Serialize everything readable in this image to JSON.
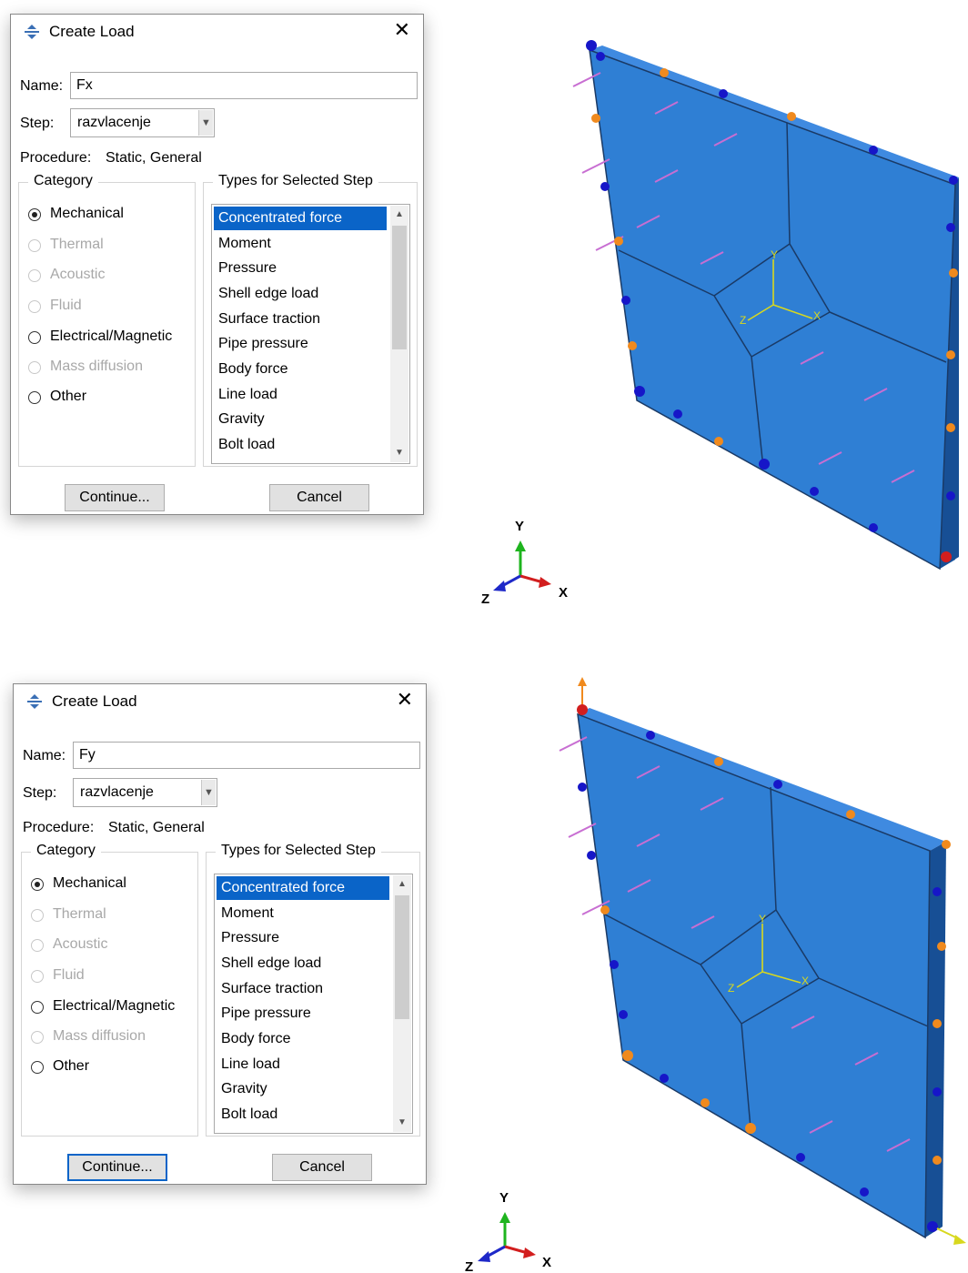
{
  "dialogs": [
    {
      "title": "Create Load",
      "name_label": "Name:",
      "name_value": "Fx",
      "step_label": "Step:",
      "step_value": "razvlacenje",
      "procedure_label": "Procedure:",
      "procedure_value": "Static, General",
      "category_title": "Category",
      "categories": [
        "Mechanical",
        "Thermal",
        "Acoustic",
        "Fluid",
        "Electrical/Magnetic",
        "Mass diffusion",
        "Other"
      ],
      "selected_category": "Mechanical",
      "types_title": "Types for Selected Step",
      "types": [
        "Concentrated force",
        "Moment",
        "Pressure",
        "Shell edge load",
        "Surface traction",
        "Pipe pressure",
        "Body force",
        "Line load",
        "Gravity",
        "Bolt load"
      ],
      "selected_type": "Concentrated force",
      "continue_label": "Continue...",
      "cancel_label": "Cancel"
    },
    {
      "title": "Create Load",
      "name_label": "Name:",
      "name_value": "Fy",
      "step_label": "Step:",
      "step_value": "razvlacenje",
      "procedure_label": "Procedure:",
      "procedure_value": "Static, General",
      "category_title": "Category",
      "categories": [
        "Mechanical",
        "Thermal",
        "Acoustic",
        "Fluid",
        "Electrical/Magnetic",
        "Mass diffusion",
        "Other"
      ],
      "selected_category": "Mechanical",
      "types_title": "Types for Selected Step",
      "types": [
        "Concentrated force",
        "Moment",
        "Pressure",
        "Shell edge load",
        "Surface traction",
        "Pipe pressure",
        "Body force",
        "Line load",
        "Gravity",
        "Bolt load"
      ],
      "selected_type": "Concentrated force",
      "continue_label": "Continue...",
      "cancel_label": "Cancel"
    }
  ],
  "viewports": [
    {
      "axis_labels": {
        "x": "X",
        "y": "Y",
        "z": "Z"
      },
      "local_axis_labels": {
        "x": "X",
        "y": "Y",
        "z": "Z"
      }
    },
    {
      "axis_labels": {
        "x": "X",
        "y": "Y",
        "z": "Z"
      },
      "local_axis_labels": {
        "x": "X",
        "y": "Y",
        "z": "Z"
      }
    }
  ],
  "colors": {
    "part_face": "#2f7fd4",
    "part_side": "#1b5fae",
    "selection_blue": "#0a64c8",
    "bc_blue": "#1616c8",
    "bc_orange": "#f08a1e",
    "load_arrow": "#c86ed2",
    "axis_x": "#d21e1e",
    "axis_y": "#1eb41e",
    "axis_z": "#1e28c8",
    "local_axis": "#d8d81e"
  }
}
